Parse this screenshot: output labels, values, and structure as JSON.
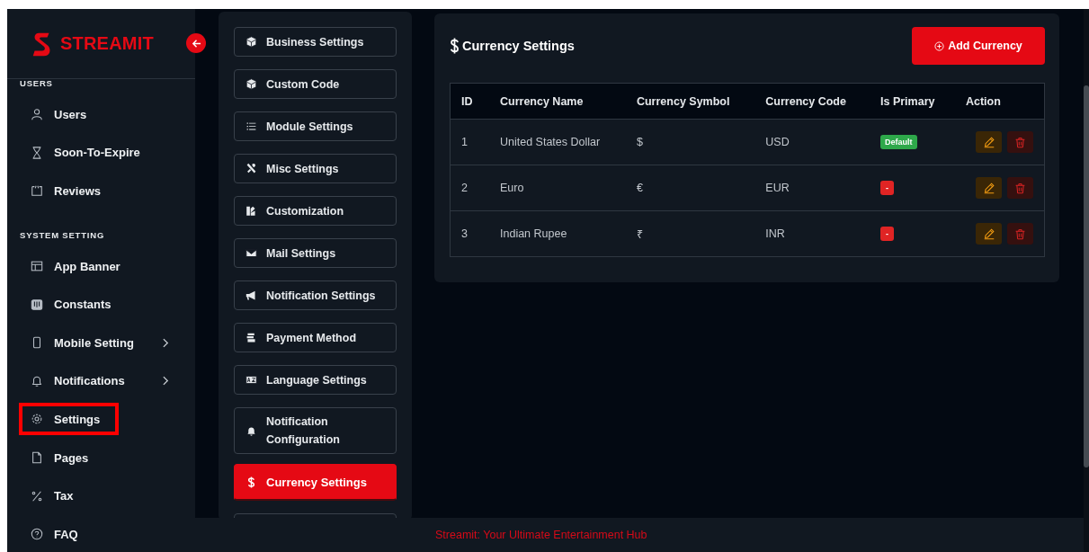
{
  "sidebar": {
    "logo": "STREAMIT",
    "sections": [
      {
        "heading": "USERS",
        "items": [
          {
            "label": "Users",
            "expandable": false,
            "highlighted": false
          },
          {
            "label": "Soon-To-Expire",
            "expandable": false,
            "highlighted": false
          },
          {
            "label": "Reviews",
            "expandable": false,
            "highlighted": false
          }
        ]
      },
      {
        "heading": "SYSTEM SETTING",
        "items": [
          {
            "label": "App Banner",
            "expandable": false,
            "highlighted": false
          },
          {
            "label": "Constants",
            "expandable": false,
            "highlighted": false
          },
          {
            "label": "Mobile Setting",
            "expandable": true,
            "highlighted": false
          },
          {
            "label": "Notifications",
            "expandable": true,
            "highlighted": false
          },
          {
            "label": "Settings",
            "expandable": false,
            "highlighted": true
          },
          {
            "label": "Pages",
            "expandable": false,
            "highlighted": false
          },
          {
            "label": "Tax",
            "expandable": false,
            "highlighted": false
          },
          {
            "label": "FAQ",
            "expandable": false,
            "highlighted": false
          }
        ]
      }
    ]
  },
  "settings_menu": [
    {
      "label": "Business Settings",
      "selected": false
    },
    {
      "label": "Custom Code",
      "selected": false
    },
    {
      "label": "Module Settings",
      "selected": false
    },
    {
      "label": "Misc Settings",
      "selected": false
    },
    {
      "label": "Customization",
      "selected": false
    },
    {
      "label": "Mail Settings",
      "selected": false
    },
    {
      "label": "Notification Settings",
      "selected": false
    },
    {
      "label": "Payment Method",
      "selected": false
    },
    {
      "label": "Language Settings",
      "selected": false
    },
    {
      "label": "Notification Configuration",
      "selected": false
    },
    {
      "label": "Currency Settings",
      "selected": true
    }
  ],
  "card": {
    "title": "Currency Settings",
    "add_button": "Add Currency",
    "table": {
      "columns": [
        "ID",
        "Currency Name",
        "Currency Symbol",
        "Currency Code",
        "Is Primary",
        "Action"
      ],
      "rows": [
        {
          "id": "1",
          "name": "United States Dollar",
          "symbol": "$",
          "code": "USD",
          "primary": true,
          "badge": "Default"
        },
        {
          "id": "2",
          "name": "Euro",
          "symbol": "€",
          "code": "EUR",
          "primary": false,
          "badge": "-"
        },
        {
          "id": "3",
          "name": "Indian Rupee",
          "symbol": "₹",
          "code": "INR",
          "primary": false,
          "badge": "-"
        }
      ]
    }
  },
  "footer": "Streamit: Your Ultimate Entertainment Hub"
}
